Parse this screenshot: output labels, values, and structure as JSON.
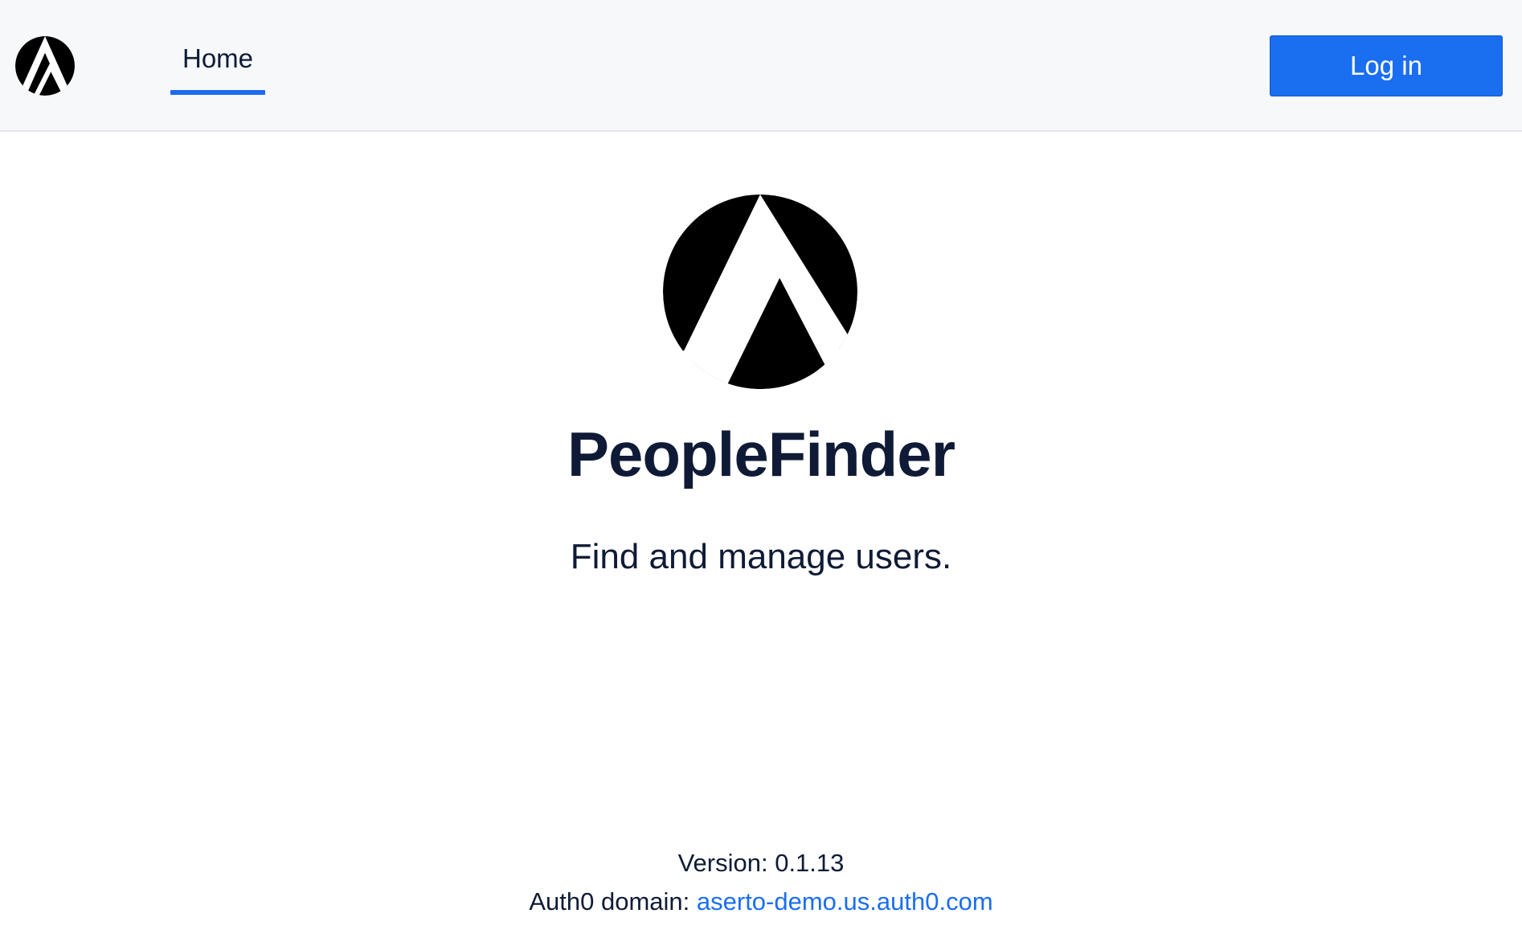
{
  "navbar": {
    "logo_icon": "aserto-logo-icon",
    "tabs": [
      {
        "label": "Home",
        "active": true
      }
    ],
    "login_label": "Log in"
  },
  "hero": {
    "logo_icon": "aserto-logo-icon",
    "title": "PeopleFinder",
    "subtitle": "Find and manage users."
  },
  "footer": {
    "version_label": "Version: 0.1.13",
    "auth0_label": "Auth0 domain: ",
    "auth0_domain": "aserto-demo.us.auth0.com"
  },
  "colors": {
    "accent": "#1a6ef0",
    "text": "#0f1b36",
    "navbar_bg": "#f7f8fa"
  }
}
